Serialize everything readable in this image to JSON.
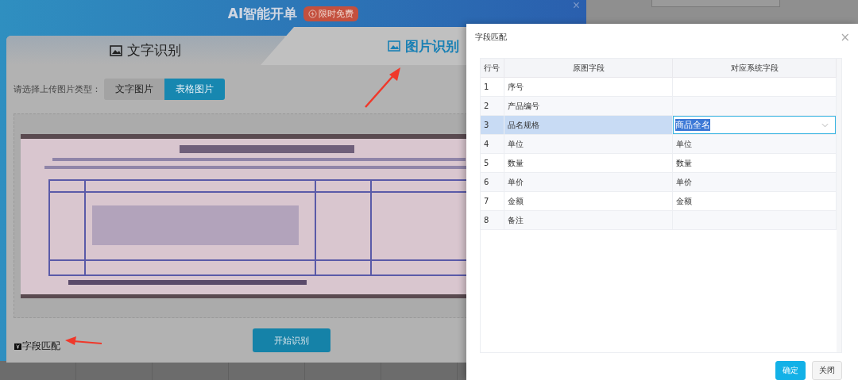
{
  "app_modal": {
    "title": "AI智能开单",
    "badge": "限时免费",
    "close": "×",
    "tabs": [
      {
        "label": "文字识别",
        "selected": false
      },
      {
        "label": "图片识别",
        "selected": true
      }
    ],
    "type_label": "请选择上传图片类型：",
    "type_options": [
      {
        "label": "文字图片",
        "selected": false
      },
      {
        "label": "表格图片",
        "selected": true
      }
    ],
    "field_match_link": "字段匹配",
    "start_button": "开始识别"
  },
  "dialog": {
    "title": "字段匹配",
    "close": "×",
    "columns": [
      "行号",
      "原图字段",
      "对应系统字段"
    ],
    "rows": [
      {
        "number": "1",
        "source": "序号",
        "selected": false
      },
      {
        "number": "2",
        "source": "产品编号",
        "selected": false
      },
      {
        "number": "3",
        "source": "品名规格",
        "selected": true,
        "target": {
          "value": "商品全名",
          "kind": "dropdown"
        }
      },
      {
        "number": "4",
        "source": "单位",
        "selected": false,
        "target": {
          "value": "单位",
          "kind": "text"
        }
      },
      {
        "number": "5",
        "source": "数量",
        "selected": false,
        "target": {
          "value": "数量",
          "kind": "text"
        }
      },
      {
        "number": "6",
        "source": "单价",
        "selected": false,
        "target": {
          "value": "单价",
          "kind": "text"
        }
      },
      {
        "number": "7",
        "source": "金额",
        "selected": false,
        "target": {
          "value": "金额",
          "kind": "text"
        }
      },
      {
        "number": "8",
        "source": "备注",
        "selected": false
      }
    ],
    "buttons": [
      {
        "label": "确定",
        "kind": "primary"
      },
      {
        "label": "关闭",
        "kind": "default"
      }
    ]
  }
}
